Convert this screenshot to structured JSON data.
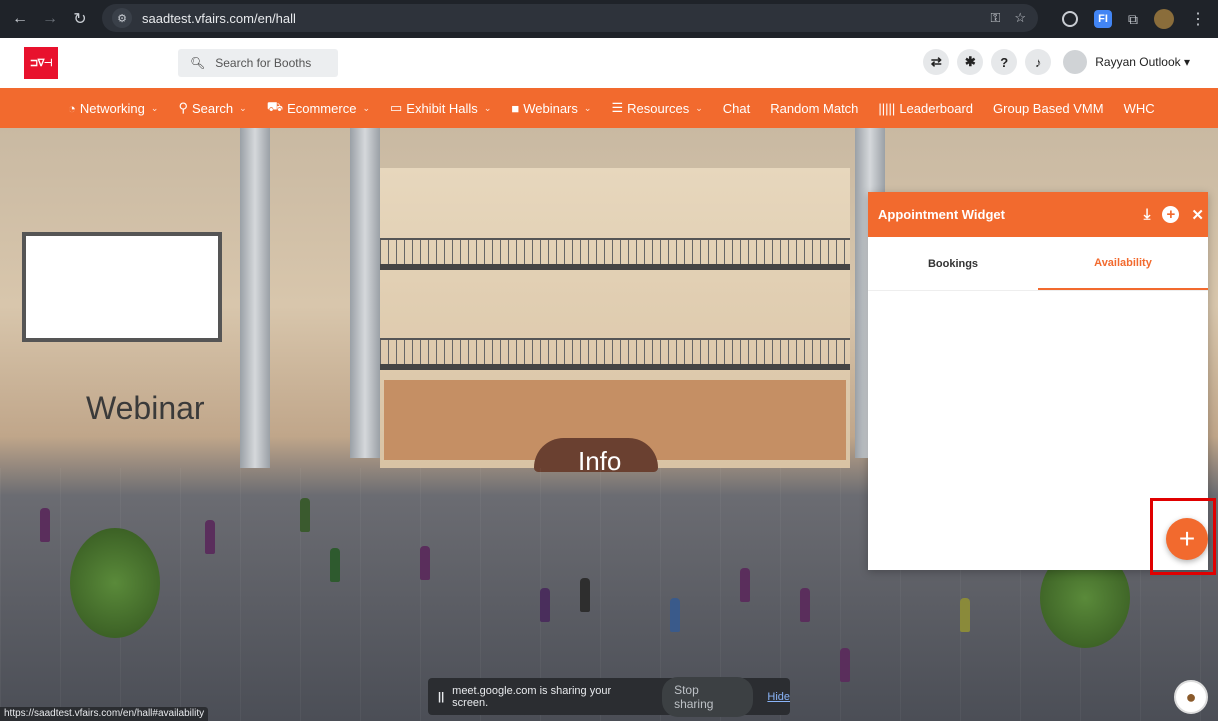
{
  "browser": {
    "url": "saadtest.vfairs.com/en/hall",
    "status_url": "https://saadtest.vfairs.com/en/hall#availability",
    "extension_fi": "FI",
    "icons": [
      "back-icon",
      "forward-icon",
      "reload-icon",
      "site-settings-icon",
      "password-key-icon",
      "bookmark-star-icon",
      "record-icon",
      "extensions-icon",
      "profile-avatar-icon",
      "kebab-menu-icon"
    ]
  },
  "header": {
    "logo_text": "⊐∇⊣",
    "search_placeholder": "Search for Booths",
    "user_name": "Rayyan Outlook ▾",
    "help_label": "?"
  },
  "nav": {
    "items": [
      {
        "label": "Networking",
        "icon": "networking-icon",
        "has_dropdown": true
      },
      {
        "label": "Search",
        "icon": "search-icon",
        "has_dropdown": true
      },
      {
        "label": "Ecommerce",
        "icon": "cart-icon",
        "has_dropdown": true
      },
      {
        "label": "Exhibit Halls",
        "icon": "monitor-icon",
        "has_dropdown": true
      },
      {
        "label": "Webinars",
        "icon": "video-icon",
        "has_dropdown": true
      },
      {
        "label": "Resources",
        "icon": "list-icon",
        "has_dropdown": true
      },
      {
        "label": "Chat",
        "icon": "",
        "has_dropdown": false
      },
      {
        "label": "Random Match",
        "icon": "",
        "has_dropdown": false
      },
      {
        "label": "Leaderboard",
        "icon": "barcode-icon",
        "has_dropdown": false
      },
      {
        "label": "Group Based VMM",
        "icon": "",
        "has_dropdown": false
      },
      {
        "label": "WHC",
        "icon": "",
        "has_dropdown": false
      }
    ]
  },
  "scene": {
    "webinar_label": "Webinar",
    "info_label": "Info"
  },
  "widget": {
    "title": "Appointment Widget",
    "tabs": [
      {
        "label": "Bookings",
        "active": false
      },
      {
        "label": "Availability",
        "active": true
      }
    ]
  },
  "fab": {
    "label": "+"
  },
  "share_bar": {
    "pause": "||",
    "message": "meet.google.com is sharing your screen.",
    "stop_label": "Stop sharing",
    "hide_label": "Hide"
  },
  "colors": {
    "brand_orange": "#f26a2e",
    "highlight_red": "#e00000",
    "logo_red": "#e8112d"
  }
}
